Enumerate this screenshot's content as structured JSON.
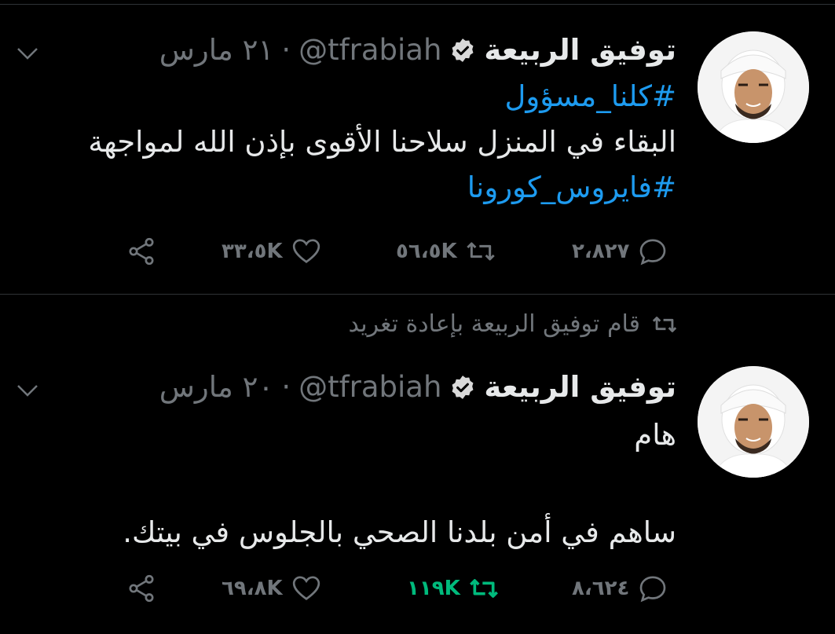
{
  "tweets": [
    {
      "display_name": "توفيق الربيعة",
      "handle": "@tfrabiah",
      "separator": "·",
      "date": "٢١ مارس",
      "text_lines": [
        {
          "type": "hashtag",
          "text": "#كلنا_مسؤول"
        },
        {
          "type": "text",
          "text": "البقاء في المنزل سلاحنا الأقوى بإذن الله لمواجهة"
        },
        {
          "type": "hashtag",
          "text": "#فايروس_كورونا"
        }
      ],
      "actions": {
        "replies": "٢،٨٢٧",
        "retweets": "٥٦،٥K",
        "likes": "٣٣،٥K"
      }
    },
    {
      "retweeted_by": "قام توفيق الربيعة بإعادة تغريد",
      "display_name": "توفيق الربيعة",
      "handle": "@tfrabiah",
      "separator": "·",
      "date": "٢٠ مارس",
      "text_lines": [
        {
          "type": "text",
          "text": "هام"
        },
        {
          "type": "text",
          "text": ""
        },
        {
          "type": "text",
          "text": "ساهم في أمن بلدنا الصحي بالجلوس في بيتك."
        }
      ],
      "actions": {
        "replies": "٨،٦٢٤",
        "retweets": "١١٩K",
        "likes": "٦٩،٨K"
      }
    }
  ],
  "colors": {
    "background": "#000000",
    "text": "#e7e9ea",
    "secondary": "#71767b",
    "hashtag": "#1d9bf0",
    "retweet_active": "#00ba7c",
    "divider": "#2f3336"
  },
  "icons": {
    "caret": "chevron-down-icon",
    "verified": "verified-badge-icon",
    "reply": "reply-icon",
    "retweet": "retweet-icon",
    "like": "heart-icon",
    "share": "share-icon"
  }
}
